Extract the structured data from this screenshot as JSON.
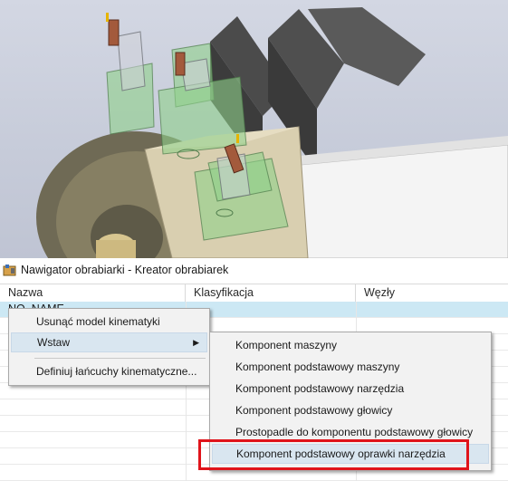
{
  "window": {
    "title": "Nawigator obrabiarki - Kreator obrabiarek"
  },
  "table": {
    "columns": [
      "Nazwa",
      "Klasyfikacja",
      "Węzły"
    ],
    "selected_row_name": "NO_NAME"
  },
  "context_menu": {
    "items": [
      {
        "label": "Usunąć model kinematyki"
      },
      {
        "label": "Wstaw",
        "has_submenu": true
      },
      {
        "label": "Definiuj łańcuchy kinematyczne..."
      }
    ]
  },
  "submenu": {
    "items": [
      {
        "label": "Komponent maszyny"
      },
      {
        "label": "Komponent podstawowy maszyny"
      },
      {
        "label": "Komponent podstawowy narzędzia"
      },
      {
        "label": "Komponent podstawowy głowicy"
      },
      {
        "label": "Prostopadle do komponentu podstawowy głowicy"
      },
      {
        "label": "Komponent podstawowy oprawki narzędzia"
      }
    ]
  },
  "icons": {
    "title_icon": "machine-navigator-icon",
    "submenu_arrow": "chevron-right-icon"
  },
  "colors": {
    "selected_row": "#cce8f4",
    "menu_hover": "#d9e6f0",
    "highlight": "#e0141b",
    "tool_body_green": "#8fd08a"
  }
}
